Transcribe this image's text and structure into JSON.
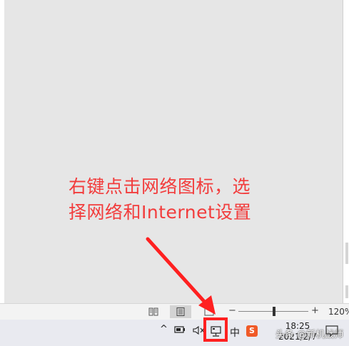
{
  "annotation": {
    "line1": "右键点击网络图标，选",
    "line2": "择网络和Internet设置",
    "color": "#f23c3c"
  },
  "statusbar": {
    "zoom_minus": "−",
    "zoom_plus": "+",
    "zoom_level": "120%",
    "zoom_fraction": 0.5,
    "views": [
      "read-mode-icon",
      "print-layout-icon",
      "web-layout-icon"
    ]
  },
  "taskbar": {
    "chevron": "^",
    "ime_label": "中",
    "sogou_label": "S",
    "clock_time": "18:25",
    "clock_date": "2021/2/7",
    "watermark": "头条 @新机战师"
  }
}
